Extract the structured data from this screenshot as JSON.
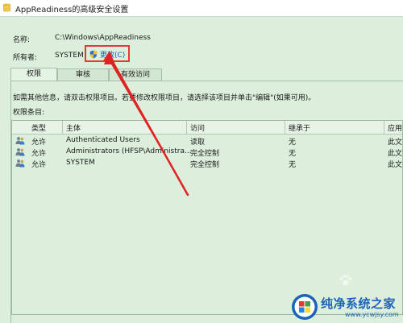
{
  "window": {
    "title": "AppReadiness的高级安全设置"
  },
  "info": {
    "name_label": "名称:",
    "name_value": "C:\\Windows\\AppReadiness",
    "owner_label": "所有者:",
    "owner_value": "SYSTEM",
    "change_link": "更改(C)"
  },
  "tabs": [
    {
      "label": "权限"
    },
    {
      "label": "审核"
    },
    {
      "label": "有效访问"
    }
  ],
  "panel": {
    "instruction": "如需其他信息，请双击权限项目。若要修改权限项目，请选择该项目并单击\"编辑\"(如果可用)。",
    "entries_label": "权限条目:"
  },
  "table": {
    "columns": [
      "类型",
      "主体",
      "访问",
      "继承于",
      "应用于"
    ],
    "rows": [
      {
        "type": "允许",
        "principal": "Authenticated Users",
        "access": "读取",
        "inherited": "无",
        "applies": "此文件夹"
      },
      {
        "type": "允许",
        "principal": "Administrators (HFSP\\Administra...",
        "access": "完全控制",
        "inherited": "无",
        "applies": "此文件夹"
      },
      {
        "type": "允许",
        "principal": "SYSTEM",
        "access": "完全控制",
        "inherited": "无",
        "applies": "此文件夹"
      }
    ]
  },
  "watermark": {
    "title": "纯净系统之家",
    "url": "www.ycwjsy.com"
  },
  "colors": {
    "window_bg": "#dcefdc",
    "link": "#1a5fb4",
    "highlight": "#e53935",
    "watermark": "#1d63b8"
  },
  "icons": {
    "title": "folder-icon",
    "change": "uac-shield-icon",
    "row": "users-icon"
  }
}
